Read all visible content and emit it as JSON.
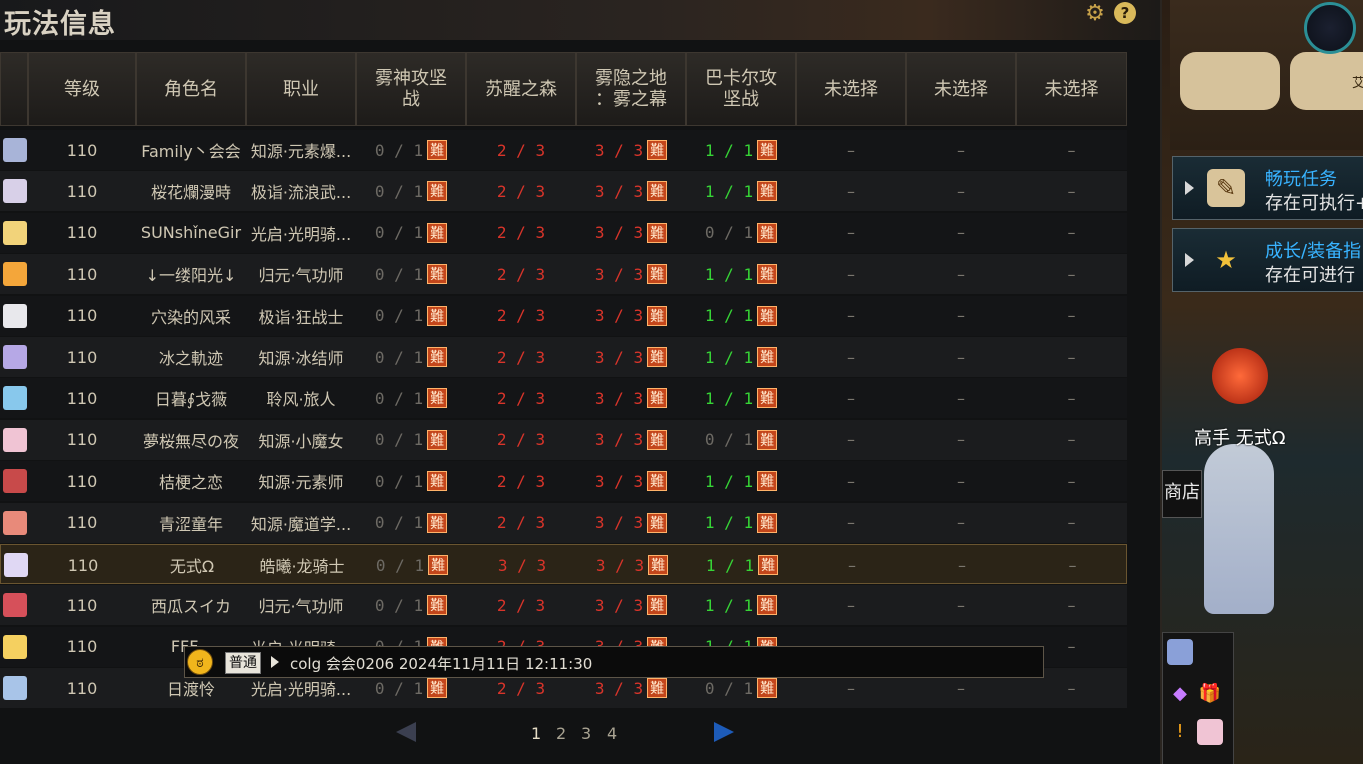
{
  "window": {
    "title": "玩法信息",
    "settings_icon": "gear-icon",
    "help_icon": "question-icon",
    "help_glyph": "?"
  },
  "table": {
    "headers": [
      "等级",
      "角色名",
      "职业",
      "雾神攻坚\n战",
      "苏醒之森",
      "雾隐之地\n：雾之幕",
      "巴卡尔攻\n坚战",
      "未选择",
      "未选择",
      "未选择"
    ],
    "rows": [
      {
        "level": "110",
        "name": "Family丶会会",
        "job": "知源·元素爆...",
        "c1": "0 / 1",
        "c2": "2 / 3",
        "c3": "3 / 3",
        "c4": "1 / 1",
        "avatar": "#a8b4d8",
        "c4color": "gr"
      },
      {
        "level": "110",
        "name": "桜花爛漫時",
        "job": "极诣·流浪武...",
        "c1": "0 / 1",
        "c2": "2 / 3",
        "c3": "3 / 3",
        "c4": "1 / 1",
        "avatar": "#d8d0e8",
        "c4color": "gr"
      },
      {
        "level": "110",
        "name": "SUNshǐneGir",
        "job": "光启·光明骑...",
        "c1": "0 / 1",
        "c2": "2 / 3",
        "c3": "3 / 3",
        "c4": "0 / 1",
        "avatar": "#f2d37a",
        "c4color": "g"
      },
      {
        "level": "110",
        "name": "↓一缕阳光↓",
        "job": "归元·气功师",
        "c1": "0 / 1",
        "c2": "2 / 3",
        "c3": "3 / 3",
        "c4": "1 / 1",
        "avatar": "#f4a63a",
        "c4color": "gr"
      },
      {
        "level": "110",
        "name": "穴染的风采",
        "job": "极诣·狂战士",
        "c1": "0 / 1",
        "c2": "2 / 3",
        "c3": "3 / 3",
        "c4": "1 / 1",
        "avatar": "#e8e8ec",
        "c4color": "gr"
      },
      {
        "level": "110",
        "name": "冰之軌迹",
        "job": "知源·冰结师",
        "c1": "0 / 1",
        "c2": "2 / 3",
        "c3": "3 / 3",
        "c4": "1 / 1",
        "avatar": "#b6a8e6",
        "c4color": "gr"
      },
      {
        "level": "110",
        "name": "日暮∮戈薇",
        "job": "聆风·旅人",
        "c1": "0 / 1",
        "c2": "2 / 3",
        "c3": "3 / 3",
        "c4": "1 / 1",
        "avatar": "#88c8ec",
        "c4color": "gr"
      },
      {
        "level": "110",
        "name": "夢桜無尽の夜",
        "job": "知源·小魔女",
        "c1": "0 / 1",
        "c2": "2 / 3",
        "c3": "3 / 3",
        "c4": "0 / 1",
        "avatar": "#f0c4d4",
        "c4color": "g"
      },
      {
        "level": "110",
        "name": "桔梗之恋",
        "job": "知源·元素师",
        "c1": "0 / 1",
        "c2": "2 / 3",
        "c3": "3 / 3",
        "c4": "1 / 1",
        "avatar": "#c84a4a",
        "c4color": "gr"
      },
      {
        "level": "110",
        "name": "青涩童年",
        "job": "知源·魔道学...",
        "c1": "0 / 1",
        "c2": "2 / 3",
        "c3": "3 / 3",
        "c4": "1 / 1",
        "avatar": "#e88a7a",
        "c4color": "gr"
      },
      {
        "level": "110",
        "name": "无式Ω",
        "job": "皓曦·龙骑士",
        "c1": "0 / 1",
        "c2": "3 / 3",
        "c3": "3 / 3",
        "c4": "1 / 1",
        "avatar": "#e0d8f4",
        "c4color": "gr",
        "selected": true
      },
      {
        "level": "110",
        "name": "西瓜スイカ",
        "job": "归元·气功师",
        "c1": "0 / 1",
        "c2": "2 / 3",
        "c3": "3 / 3",
        "c4": "1 / 1",
        "avatar": "#d6505a",
        "c4color": "gr"
      },
      {
        "level": "110",
        "name": "FFF...",
        "job": "光启·光明骑...",
        "c1": "0 / 1",
        "c2": "2 / 3",
        "c3": "3 / 3",
        "c4": "1 / 1",
        "avatar": "#f5d060",
        "c4color": "gr"
      },
      {
        "level": "110",
        "name": "日渡怜",
        "job": "光启·光明骑...",
        "c1": "0 / 1",
        "c2": "2 / 3",
        "c3": "3 / 3",
        "c4": "0 / 1",
        "avatar": "#a8c4e8",
        "c4color": "g"
      }
    ],
    "hard_tag": "難",
    "empty": "–"
  },
  "pagination": {
    "pages": [
      "1",
      "2",
      "3",
      "4"
    ],
    "current": "1"
  },
  "chat": {
    "badge": "普通",
    "text": "colg 会会0206 2024年11月11日 12:11:30"
  },
  "sidebar": {
    "map_label": "艾",
    "quests": [
      {
        "title": "畅玩任务",
        "subtitle": "存在可执行+",
        "icon": "scroll-icon"
      },
      {
        "title": "成长/装备指",
        "subtitle": "存在可进行",
        "icon": "star-book-icon"
      }
    ],
    "character_title": "高手 无式Ω",
    "shop_label": "商店"
  }
}
